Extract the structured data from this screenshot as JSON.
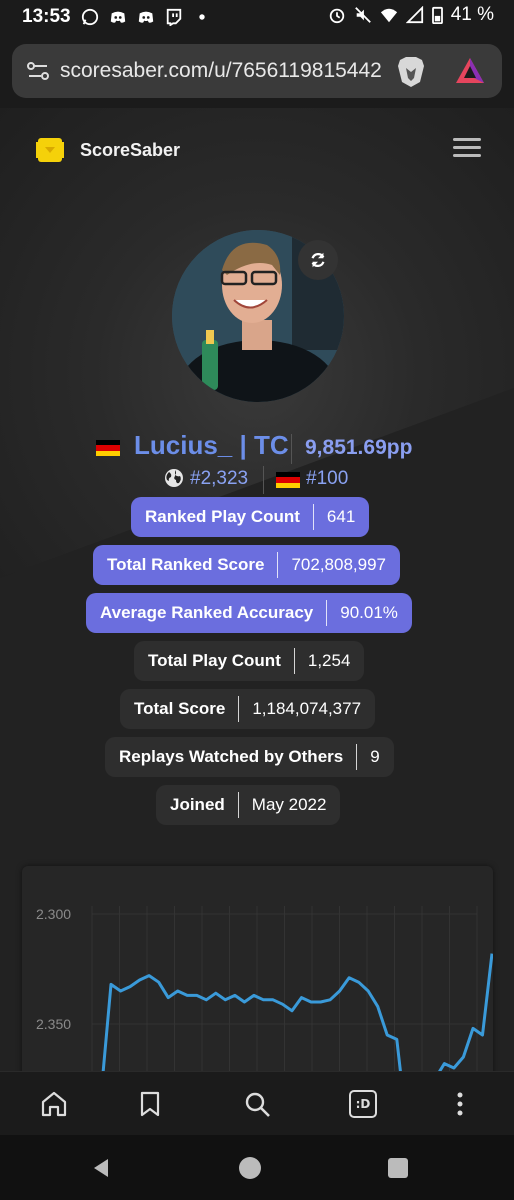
{
  "status_bar": {
    "time": "13:53",
    "battery": "41 %",
    "icons_left": [
      "whatsapp-icon",
      "discord-icon",
      "discord-icon",
      "twitch-icon",
      "dot-icon"
    ],
    "icons_right": [
      "alarm-icon",
      "mute-icon",
      "wifi-icon",
      "signal-icon",
      "battery-icon"
    ]
  },
  "browser": {
    "url": "scoresaber.com/u/7656119815442"
  },
  "site": {
    "brand": "ScoreSaber"
  },
  "profile": {
    "name": "Lucius_ | TC",
    "pp": "9,851.69pp",
    "global_rank": "#2,323",
    "country_rank": "#100",
    "country": "Germany"
  },
  "stats": [
    {
      "label": "Ranked Play Count",
      "value": "641",
      "style": "blue"
    },
    {
      "label": "Total Ranked Score",
      "value": "702,808,997",
      "style": "blue"
    },
    {
      "label": "Average Ranked Accuracy",
      "value": "90.01%",
      "style": "blue"
    },
    {
      "label": "Total Play Count",
      "value": "1,254",
      "style": "dark"
    },
    {
      "label": "Total Score",
      "value": "1,184,074,377",
      "style": "dark"
    },
    {
      "label": "Replays Watched by Others",
      "value": "9",
      "style": "dark"
    },
    {
      "label": "Joined",
      "value": "May 2022",
      "style": "dark"
    }
  ],
  "chart_data": {
    "type": "line",
    "title": "",
    "xlabel": "",
    "ylabel": "",
    "y_ticks": [
      "2.300",
      "2.350"
    ],
    "ylim": [
      2370,
      2290
    ],
    "y_inverted": true,
    "series": [
      {
        "values": [
          2400,
          2380,
          2332,
          2335,
          2333,
          2330,
          2328,
          2331,
          2338,
          2335,
          2337,
          2337,
          2339,
          2336,
          2339,
          2337,
          2340,
          2337,
          2339,
          2339,
          2341,
          2344,
          2338,
          2340,
          2340,
          2339,
          2335,
          2329,
          2331,
          2335,
          2342,
          2355,
          2357,
          2395,
          2420,
          2420,
          2375,
          2368,
          2370,
          2365,
          2352,
          2355,
          2318
        ]
      }
    ],
    "color": "#3a9ad9",
    "grid": true
  },
  "bottom_nav": [
    "home-icon",
    "bookmark-icon",
    "search-icon",
    "tab-switcher-icon",
    "more-icon"
  ],
  "bottom_nav_tab_label": ":D"
}
